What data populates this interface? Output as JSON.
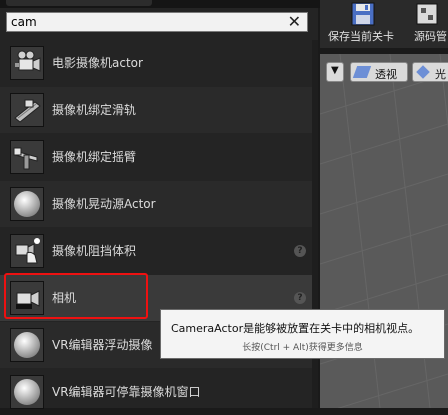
{
  "search": {
    "value": "cam"
  },
  "items": [
    {
      "label": "电影摄像机actor",
      "help": false,
      "icon": "cinema-camera-icon"
    },
    {
      "label": "摄像机绑定滑轨",
      "help": false,
      "icon": "camera-rail-icon"
    },
    {
      "label": "摄像机绑定摇臂",
      "help": false,
      "icon": "camera-crane-icon"
    },
    {
      "label": "摄像机晃动源Actor",
      "help": false,
      "icon": "sphere-icon"
    },
    {
      "label": "摄像机阻挡体积",
      "help": true,
      "icon": "blocking-volume-icon"
    },
    {
      "label": "相机",
      "help": true,
      "icon": "camera-icon"
    },
    {
      "label": "VR编辑器浮动摄像",
      "help": false,
      "icon": "sphere-icon"
    },
    {
      "label": "VR编辑器可停靠摄像机窗口",
      "help": false,
      "icon": "sphere-icon"
    }
  ],
  "toolbar": {
    "save_label": "保存当前关卡",
    "source_label": "源码管"
  },
  "viewport": {
    "perspective_label": "透视",
    "lit_label": "光"
  },
  "tooltip": {
    "title": "CameraActor是能够被放置在关卡中的相机视点。",
    "hint": "长按(Ctrl + Alt)获得更多信息"
  }
}
